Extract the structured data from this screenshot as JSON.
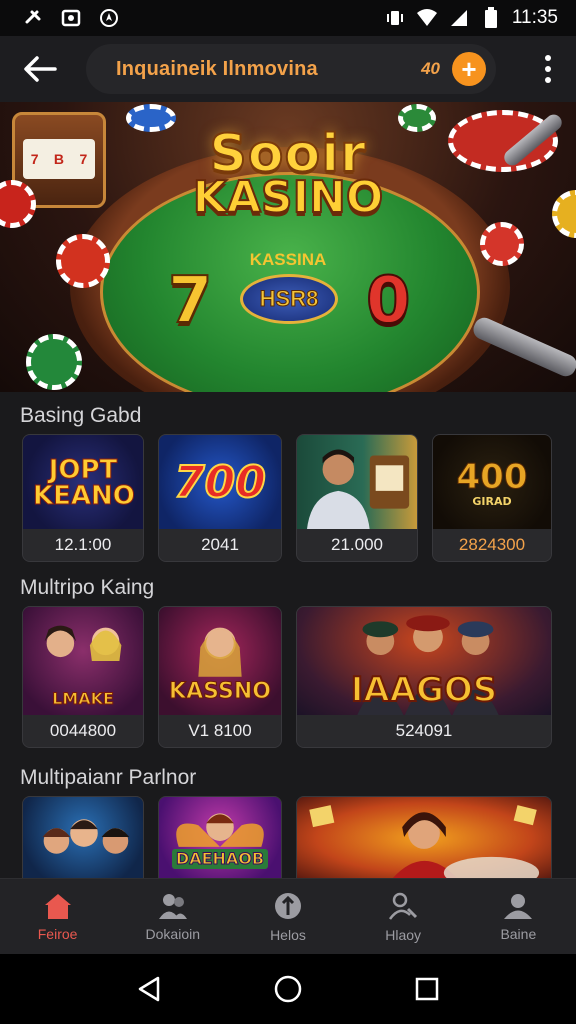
{
  "status_bar": {
    "time": "11:35",
    "left_icons": [
      "usb-icon",
      "photo-icon",
      "location-icon"
    ],
    "right_icons": [
      "vibrate-icon",
      "wifi-icon",
      "signal-icon",
      "battery-icon"
    ]
  },
  "app_bar": {
    "title": "Inquaineik Ilnmovina",
    "coin_count": "40",
    "add_label": "+"
  },
  "hero": {
    "logo_top": "Sooir",
    "logo_main": "KASINO",
    "subtitle": "KASSINA",
    "left_number": "7",
    "badge": "HSR8",
    "right_number": "0"
  },
  "sections": [
    {
      "title": "Basing Gabd",
      "cards": [
        {
          "art": "JOPT KEANO",
          "label": "12.1:00"
        },
        {
          "art": "700",
          "label": "2041"
        },
        {
          "art": "",
          "label": "21.000"
        },
        {
          "art": "400",
          "art_sub": "GIRAD",
          "label": "2824300"
        }
      ]
    },
    {
      "title": "Multripo Kaing",
      "cards": [
        {
          "art": "LMAKE",
          "label": "0044800"
        },
        {
          "art": "KASSNO",
          "label": "V1 8100"
        },
        {
          "art": "IAAGOS",
          "label": "524091"
        }
      ]
    },
    {
      "title": "Multipaianr Parlnor",
      "cards": [
        {
          "art": ""
        },
        {
          "art": "DAEHAOB"
        },
        {
          "art": ""
        }
      ]
    }
  ],
  "bottom_nav": [
    {
      "label": "Feiroe",
      "icon": "home-icon",
      "active": true
    },
    {
      "label": "Dokaioin",
      "icon": "users-icon",
      "active": false
    },
    {
      "label": "Helos",
      "icon": "location-pin-icon",
      "active": false
    },
    {
      "label": "Hlaoy",
      "icon": "profile-search-icon",
      "active": false
    },
    {
      "label": "Baine",
      "icon": "group-icon",
      "active": false
    }
  ],
  "colors": {
    "accent": "#f3a24a",
    "add_button": "#f7931e",
    "active_nav": "#e9584f",
    "background": "#1a1a1c"
  }
}
